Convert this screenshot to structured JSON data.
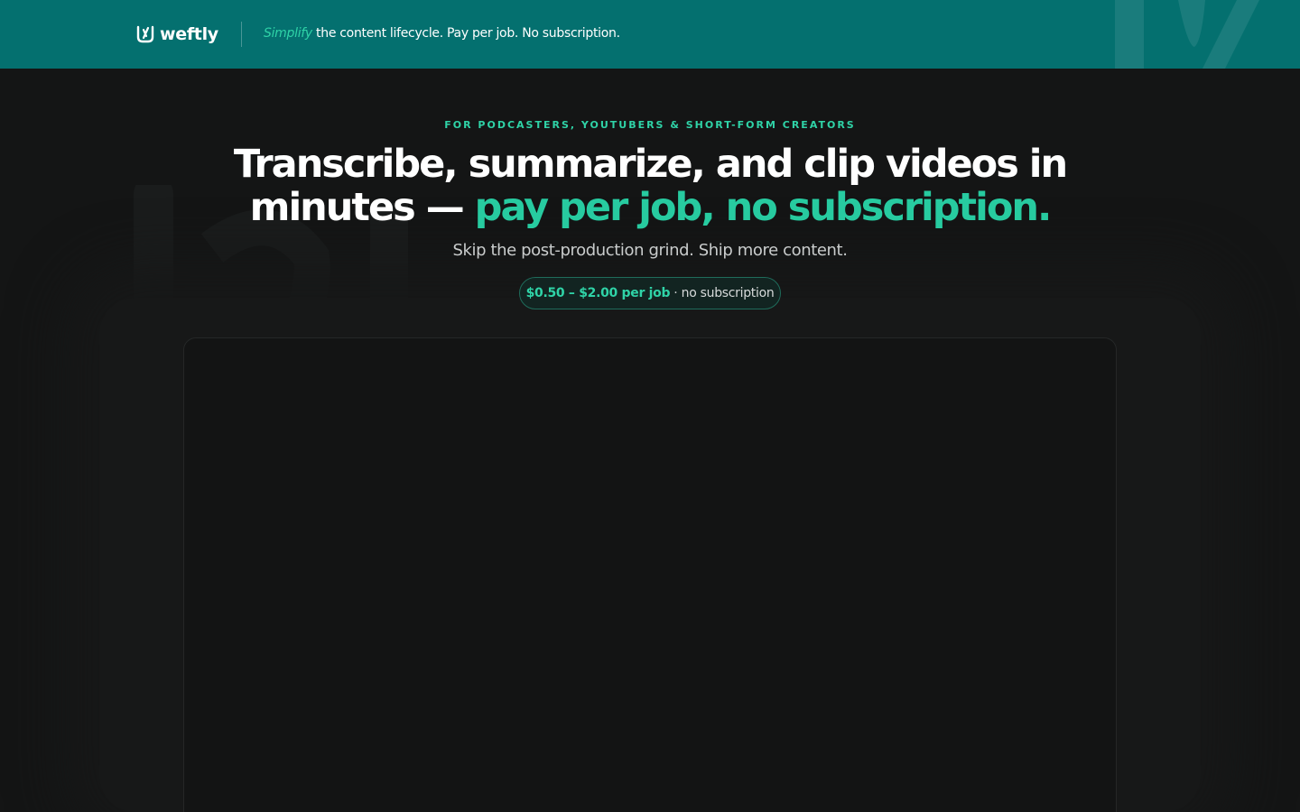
{
  "header": {
    "brand": "weftly",
    "tagline_accent": "Simplify",
    "tagline_rest": " the content lifecycle. Pay per job. No subscription."
  },
  "hero": {
    "eyebrow": "FOR PODCASTERS, YOUTUBERS & SHORT-FORM CREATORS",
    "headline_main": "Transcribe, summarize, and clip videos in minutes — ",
    "headline_highlight": "pay per job, no subscription.",
    "subhead": "Skip the post-production grind. Ship more content.",
    "pricing_pill": {
      "price": "$0.50 – $2.00 per job",
      "separator": "·",
      "note": "no subscription"
    }
  },
  "colors": {
    "topbar": "#04706f",
    "accent": "#2fd3a7",
    "background": "#141515"
  },
  "icons": {
    "logo": "weftly-logo-mark"
  }
}
